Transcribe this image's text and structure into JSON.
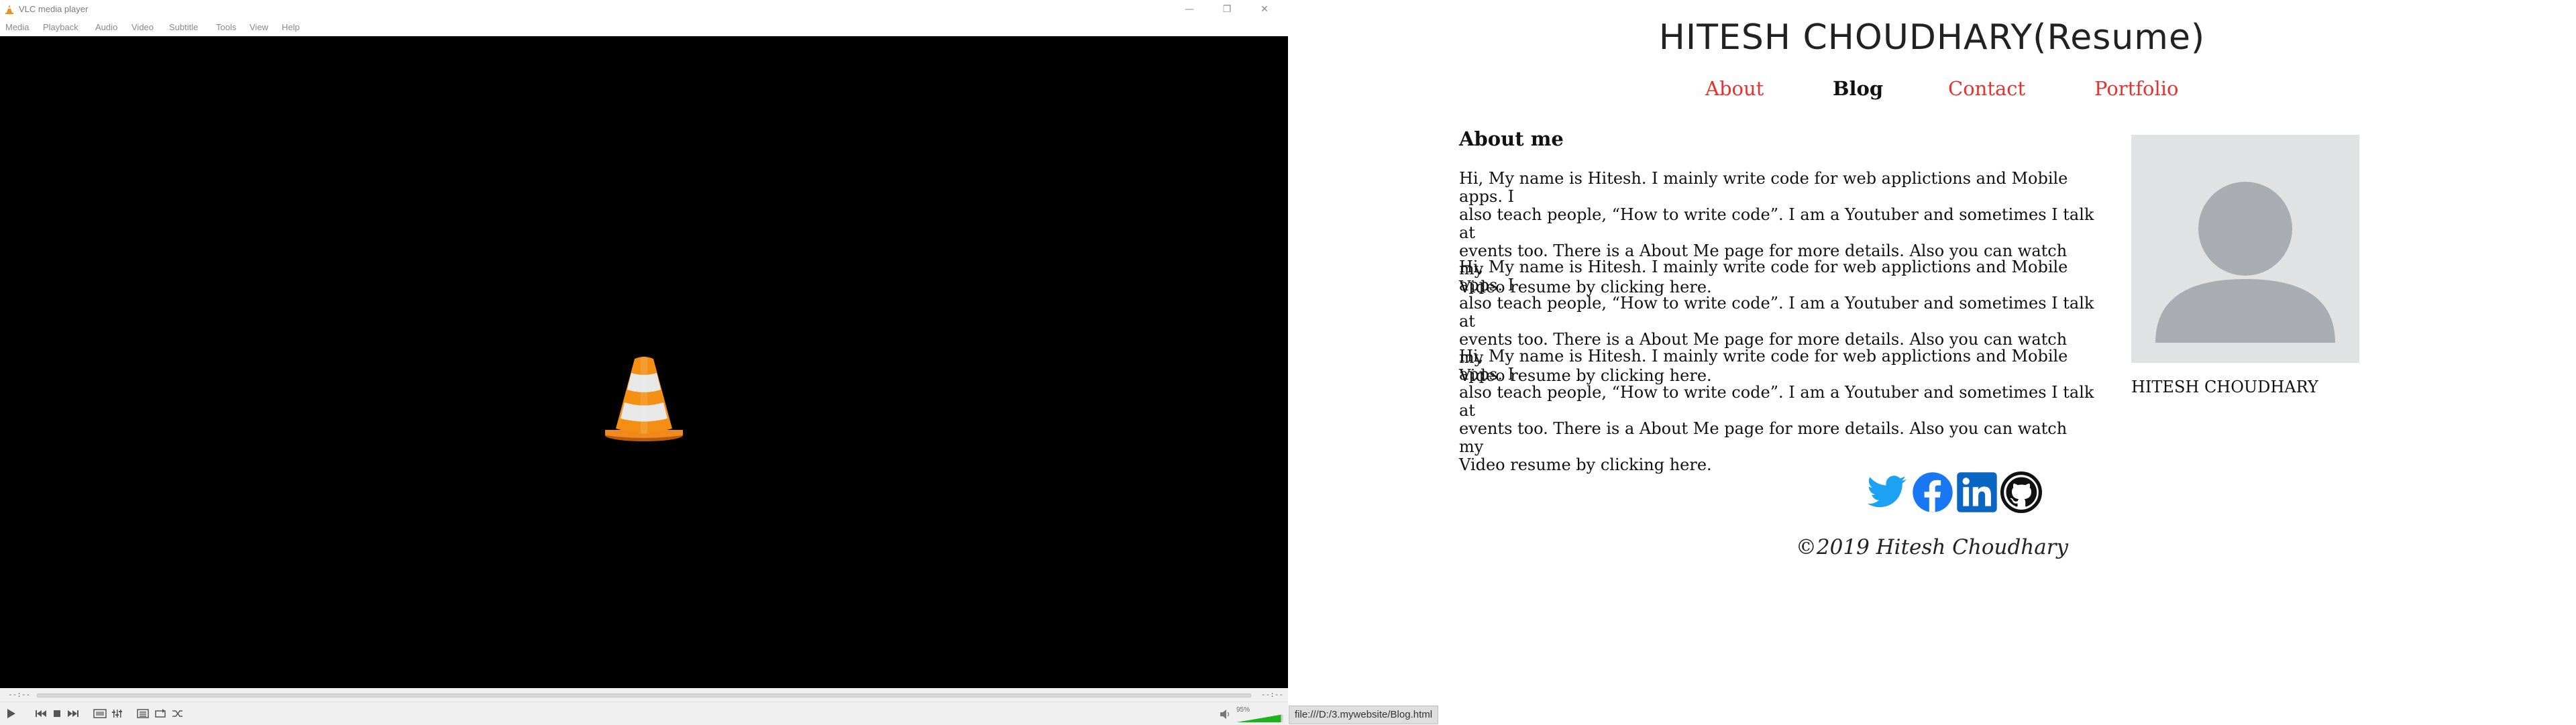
{
  "vlc": {
    "window_title": "VLC media player",
    "window_controls": [
      "—",
      "❐",
      "✕"
    ],
    "menu": [
      "Media",
      "Playback",
      "Audio",
      "Video",
      "Subtitle",
      "Tools",
      "View",
      "Help"
    ],
    "time_elapsed": "--:--",
    "time_total": "--:--",
    "volume_label": "95%",
    "volume_level": 0.95,
    "icons": [
      "vlc-cone-icon",
      "play-icon",
      "previous-icon",
      "stop-icon",
      "next-icon",
      "fullscreen-icon",
      "extended-settings-icon",
      "playlist-icon",
      "loop-icon",
      "shuffle-icon",
      "speaker-icon"
    ]
  },
  "status": {
    "url": "file:///D:/3.mywebsite/Blog.html"
  },
  "site": {
    "title": "HITESH CHOUDHARY(Resume)",
    "nav": [
      "About",
      "Blog",
      "Contact",
      "Portfolio"
    ],
    "nav_active": "Blog",
    "about_heading": "About me",
    "paragraphs": [
      [
        "Hi, My name is Hitesh. I mainly write code for web applictions and Mobile apps. I",
        "also teach people, “How to write code”. I am a Youtuber and sometimes I talk at",
        "events too. There is a About Me page for more details. Also you can watch my",
        "Video resume by clicking here."
      ],
      [
        "Hi, My name is Hitesh. I mainly write code for web applictions and Mobile apps. I",
        "also teach people, “How to write code”. I am a Youtuber and sometimes I talk at",
        "events too. There is a About Me page for more details. Also you can watch my",
        "Video resume by clicking here."
      ],
      [
        "Hi, My name is Hitesh. I mainly write code for web applictions and Mobile apps. I",
        "also teach people, “How to write code”. I am a Youtuber and sometimes I talk at",
        "events too. There is a About Me page for more details. Also you can watch my",
        "Video resume by clicking here."
      ]
    ],
    "profile_name": "HITESH CHOUDHARY",
    "social": [
      "twitter-icon",
      "facebook-icon",
      "linkedin-icon",
      "github-icon"
    ],
    "footer": "©2019 Hitesh Choudhary",
    "colors": {
      "nav_link": "#e8322e",
      "twitter": "#1da1f2",
      "facebook": "#1877f2",
      "linkedin": "#0a66c2",
      "github": "#111111",
      "avatar_bg": "#e1e2e4",
      "avatar_fg": "#a9adb2"
    }
  }
}
